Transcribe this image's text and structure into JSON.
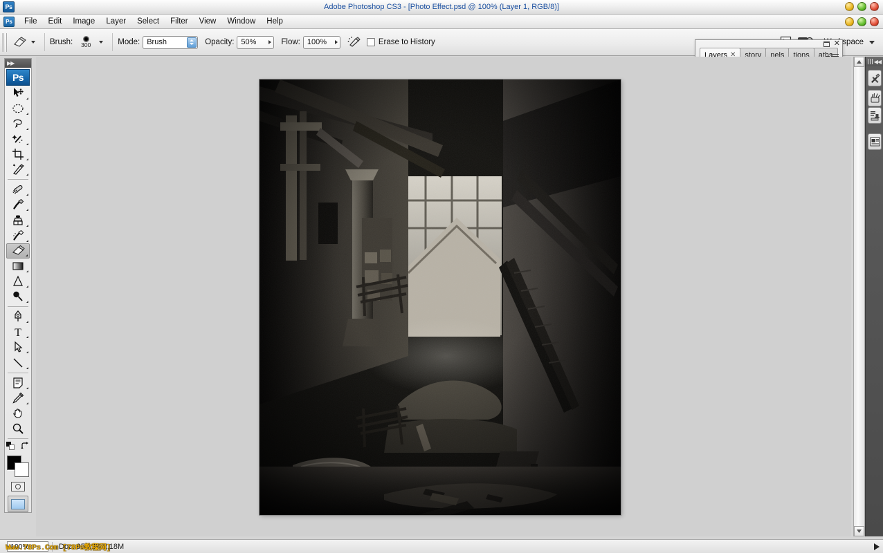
{
  "window": {
    "title": "Adobe Photoshop CS3 - [Photo Effect.psd @ 100% (Layer 1, RGB/8)]",
    "app_badge": "Ps",
    "controls": [
      {
        "name": "minimize",
        "label": "",
        "color": "#e8b41e"
      },
      {
        "name": "maximize",
        "label": "",
        "color": "#5fbb2a"
      },
      {
        "name": "close",
        "label": "",
        "color": "#e04a33"
      }
    ]
  },
  "menubar": {
    "badge": "Ps",
    "items": [
      {
        "label": "File"
      },
      {
        "label": "Edit"
      },
      {
        "label": "Image"
      },
      {
        "label": "Layer"
      },
      {
        "label": "Select"
      },
      {
        "label": "Filter"
      },
      {
        "label": "View"
      },
      {
        "label": "Window"
      },
      {
        "label": "Help"
      }
    ]
  },
  "options_bar": {
    "tool": "eraser-tool",
    "brush_label": "Brush:",
    "brush_size": "300",
    "mode_label": "Mode:",
    "mode_value": "Brush",
    "opacity_label": "Opacity:",
    "opacity_value": "50%",
    "flow_label": "Flow:",
    "flow_value": "100%",
    "erase_to_history_label": "Erase to History",
    "workspace_label": "Workspace",
    "bridge_label": "Br"
  },
  "toolbox": {
    "logo": "Ps",
    "tools": [
      {
        "name": "move-tool",
        "glyph": "move",
        "sub": true,
        "active": false
      },
      {
        "name": "marquee-tool",
        "glyph": "marquee",
        "sub": true,
        "active": false
      },
      {
        "name": "lasso-tool",
        "glyph": "lasso",
        "sub": true,
        "active": false
      },
      {
        "name": "magic-wand-tool",
        "glyph": "wand",
        "sub": true,
        "active": false
      },
      {
        "name": "crop-tool",
        "glyph": "crop",
        "sub": true,
        "active": false
      },
      {
        "name": "slice-tool",
        "glyph": "slice",
        "sub": true,
        "active": false
      },
      {
        "name": "healing-brush-tool",
        "glyph": "healing",
        "sub": true,
        "active": false
      },
      {
        "name": "brush-tool",
        "glyph": "brush",
        "sub": true,
        "active": false
      },
      {
        "name": "clone-stamp-tool",
        "glyph": "stamp",
        "sub": true,
        "active": false
      },
      {
        "name": "history-brush-tool",
        "glyph": "histbrush",
        "sub": true,
        "active": false
      },
      {
        "name": "eraser-tool",
        "glyph": "eraser",
        "sub": true,
        "active": true
      },
      {
        "name": "gradient-tool",
        "glyph": "gradient",
        "sub": true,
        "active": false
      },
      {
        "name": "blur-tool",
        "glyph": "blur",
        "sub": true,
        "active": false
      },
      {
        "name": "dodge-tool",
        "glyph": "dodge",
        "sub": true,
        "active": false
      },
      {
        "name": "pen-tool",
        "glyph": "pen",
        "sub": true,
        "active": false
      },
      {
        "name": "type-tool",
        "glyph": "type",
        "sub": true,
        "active": false
      },
      {
        "name": "path-selection-tool",
        "glyph": "pathsel",
        "sub": true,
        "active": false
      },
      {
        "name": "line-tool",
        "glyph": "line",
        "sub": true,
        "active": false
      },
      {
        "name": "notes-tool",
        "glyph": "notes",
        "sub": true,
        "active": false
      },
      {
        "name": "eyedropper-tool",
        "glyph": "eyedrop",
        "sub": true,
        "active": false
      },
      {
        "name": "hand-tool",
        "glyph": "hand",
        "sub": false,
        "active": false
      },
      {
        "name": "zoom-tool",
        "glyph": "zoom",
        "sub": false,
        "active": false
      }
    ],
    "foreground_color": "#000000",
    "background_color": "#ffffff"
  },
  "panel": {
    "tabs": [
      {
        "label": "Layers",
        "selected": true,
        "closable": true
      },
      {
        "label": "story",
        "selected": false,
        "closable": false
      },
      {
        "label": "nels",
        "selected": false,
        "closable": false
      },
      {
        "label": "tions",
        "selected": false,
        "closable": false
      },
      {
        "label": "aths",
        "selected": false,
        "closable": false
      }
    ]
  },
  "right_dock": {
    "buttons": [
      {
        "name": "tool-presets-panel-icon"
      },
      {
        "name": "brushes-panel-icon"
      },
      {
        "name": "clone-source-panel-icon"
      },
      {
        "name": "layer-comps-panel-icon"
      }
    ]
  },
  "canvas": {
    "document_name": "Photo Effect.psd",
    "zoom": "100%",
    "color_mode": "RGB/8",
    "layer": "Layer 1",
    "image_alt": "Dark abandoned industrial interior with concrete pillars, broken beams, rubble and a bright window"
  },
  "statusbar": {
    "zoom_value": "100%",
    "doc_info": "Doc: 958,2K/2,18M",
    "watermark": "Www.78Ps.Com [78Ps教程网]"
  }
}
